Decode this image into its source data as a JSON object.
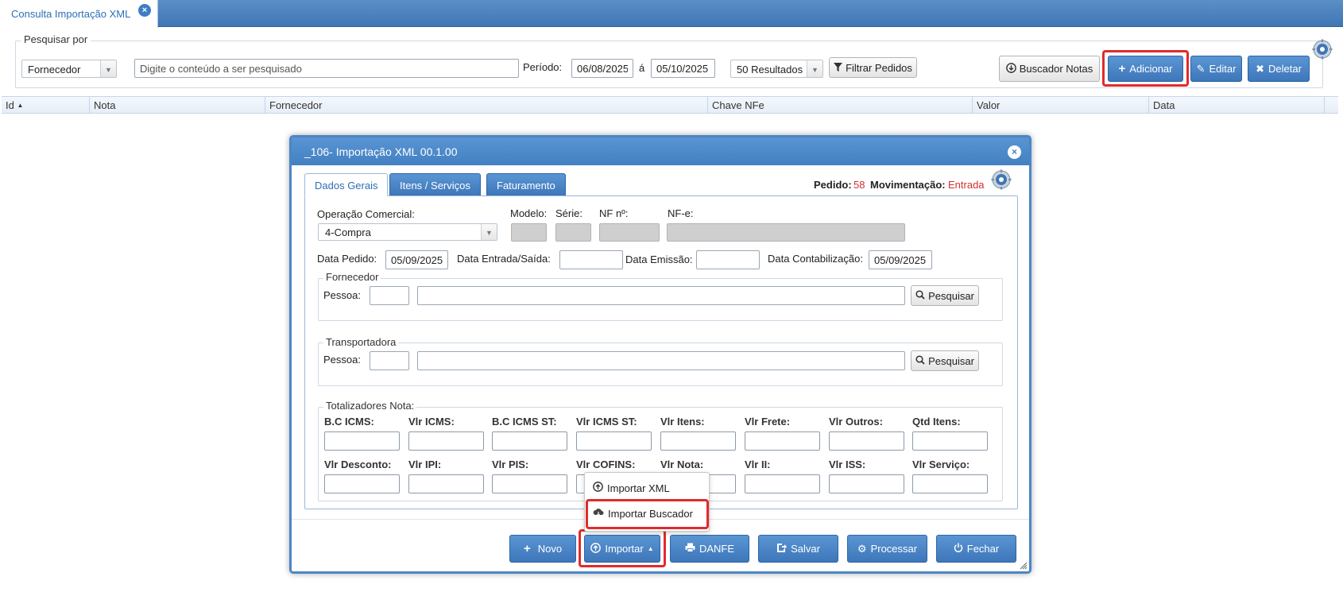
{
  "tab": {
    "title": "Consulta Importação XML",
    "close_icon": "×"
  },
  "search": {
    "legend": "Pesquisar por",
    "field_select": "Fornecedor",
    "query_placeholder": "Digite o conteúdo a ser pesquisado",
    "period_label": "Período:",
    "date_from": "06/08/2025",
    "date_separator": "á",
    "date_to": "05/10/2025",
    "results_select": "50 Resultados",
    "filter_button": "Filtrar Pedidos"
  },
  "toolbar": {
    "buscador_notas": "Buscador Notas",
    "adicionar": "Adicionar",
    "editar": "Editar",
    "deletar": "Deletar"
  },
  "grid": {
    "columns": [
      "Id",
      "Nota",
      "Fornecedor",
      "Chave NFe",
      "Valor",
      "Data"
    ]
  },
  "modal": {
    "title": "_106- Importação XML 00.1.00",
    "tabs": [
      "Dados Gerais",
      "Itens / Serviços",
      "Faturamento"
    ],
    "pedido_label": "Pedido:",
    "pedido_value": "58",
    "movimentacao_label": "Movimentação:",
    "movimentacao_value": "Entrada",
    "operacao_label": "Operação Comercial:",
    "operacao_value": "4-Compra",
    "modelo_label": "Modelo:",
    "serie_label": "Série:",
    "nf_label": "NF nº:",
    "nfe_label": "NF-e:",
    "data_pedido_label": "Data Pedido:",
    "data_pedido_value": "05/09/2025",
    "data_entrada_label": "Data Entrada/Saída:",
    "data_emissao_label": "Data Emissão:",
    "data_contab_label": "Data Contabilização:",
    "data_contab_value": "05/09/2025",
    "fornecedor_legend": "Fornecedor",
    "transportadora_legend": "Transportadora",
    "pessoa_label": "Pessoa:",
    "pesquisar_button": "Pesquisar",
    "totalizadores_legend": "Totalizadores Nota:",
    "totals_row1": [
      "B.C ICMS:",
      "Vlr ICMS:",
      "B.C ICMS ST:",
      "Vlr ICMS ST:",
      "Vlr Itens:",
      "Vlr Frete:",
      "Vlr Outros:",
      "Qtd Itens:"
    ],
    "totals_row2": [
      "Vlr Desconto:",
      "Vlr IPI:",
      "Vlr PIS:",
      "Vlr COFINS:",
      "Vlr Nota:",
      "Vlr II:",
      "Vlr ISS:",
      "Vlr Serviço:"
    ],
    "footer_buttons": {
      "novo": "Novo",
      "importar": "Importar",
      "danfe": "DANFE",
      "salvar": "Salvar",
      "processar": "Processar",
      "fechar": "Fechar"
    },
    "dropdown": {
      "importar_xml": "Importar XML",
      "importar_buscador": "Importar Buscador"
    }
  },
  "colors": {
    "accent": "#4280c2",
    "highlight": "#e02b2b",
    "pedido": "#d32f2f"
  }
}
